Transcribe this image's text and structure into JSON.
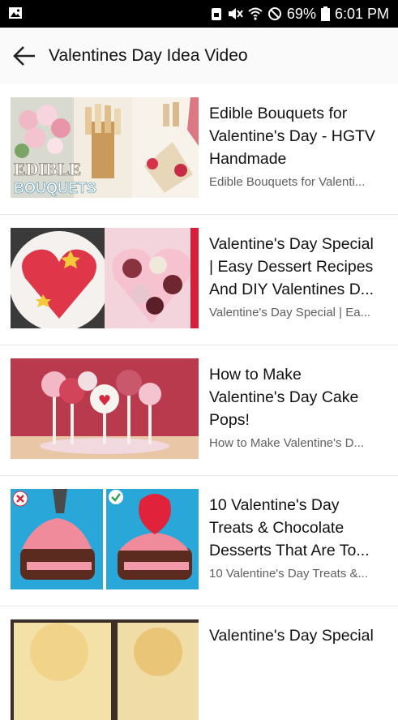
{
  "status_bar": {
    "battery_percent": "69%",
    "time": "6:01 PM",
    "icons": [
      "image-icon",
      "screenshot-lock-icon",
      "mute-icon",
      "wifi-icon",
      "do-not-disturb-icon",
      "battery-icon"
    ]
  },
  "header": {
    "back_icon": "arrow-left-icon",
    "title": "Valentines Day Idea Video"
  },
  "videos": [
    {
      "title_lines": [
        "Edible Bouquets for",
        "Valentine's Day - HGTV",
        "Handmade"
      ],
      "subtitle": "Edible Bouquets for Valenti...",
      "thumb_text": [
        "EDIBLE",
        "BOUQUETS"
      ]
    },
    {
      "title_lines": [
        "Valentine's Day Special",
        "| Easy Dessert Recipes",
        "And DIY Valentines D..."
      ],
      "subtitle": "Valentine's Day Special | Ea..."
    },
    {
      "title_lines": [
        "How to Make",
        "Valentine's Day Cake",
        "Pops!"
      ],
      "subtitle": "How to Make Valentine's D..."
    },
    {
      "title_lines": [
        "10 Valentine's Day",
        "Treats & Chocolate",
        "Desserts That Are To..."
      ],
      "subtitle": "10 Valentine's Day Treats &..."
    },
    {
      "title_lines": [
        "Valentine's Day Special"
      ],
      "subtitle": ""
    }
  ]
}
